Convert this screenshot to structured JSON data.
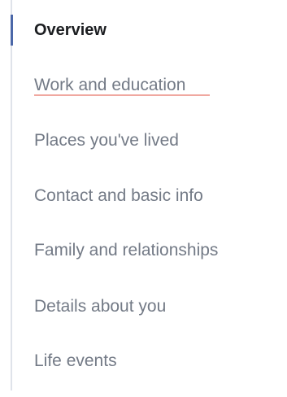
{
  "nav": {
    "items": [
      {
        "label": "Overview",
        "active": true
      },
      {
        "label": "Work and education",
        "active": false
      },
      {
        "label": "Places you've lived",
        "active": false
      },
      {
        "label": "Contact and basic info",
        "active": false
      },
      {
        "label": "Family and relationships",
        "active": false
      },
      {
        "label": "Details about you",
        "active": false
      },
      {
        "label": "Life events",
        "active": false
      }
    ]
  },
  "colors": {
    "active_indicator": "#4b67a8",
    "rail": "#dfe3ea",
    "active_text": "#1c1e21",
    "inactive_text": "#737a86",
    "spellcheck_underline": "#f0a8a0"
  }
}
